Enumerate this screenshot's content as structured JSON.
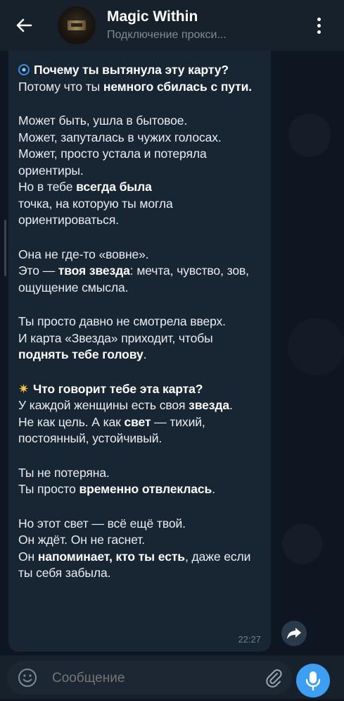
{
  "header": {
    "title": "Magic Within",
    "status": "Подключение прокси..."
  },
  "message": {
    "heading1": "Почему ты вытянула эту карту?",
    "p1_text": "Потому что ты ",
    "p1_bold": "немного сбилась с пути.",
    "p2_line1": "Может быть, ушла в бытовое.",
    "p2_line2": "Может, запуталась в чужих голосах.",
    "p2_line3": "Может, просто устала и потеряла ориентиры.",
    "p2_line4_a": "Но в тебе ",
    "p2_line4_bold": "всегда была",
    "p2_line5": "точка, на которую ты могла ориентироваться.",
    "p3_line1": "Она не где-то «вовне».",
    "p3_line2_a": "Это — ",
    "p3_line2_bold": "твоя звезда",
    "p3_line2_b": ": мечта, чувство, зов, ощущение смысла.",
    "p4_line1": "Ты просто давно не смотрела вверх.",
    "p4_line2": "И карта «Звезда» приходит, чтобы ",
    "p4_line2_bold": "поднять тебе голову",
    "p4_line2_end": ".",
    "heading2": "Что говорит тебе эта карта?",
    "p5_line1_a": "У каждой женщины есть своя ",
    "p5_line1_bold": "звезда",
    "p5_line1_end": ".",
    "p5_line2_a": "Не как цель. А как ",
    "p5_line2_bold": "свет",
    "p5_line2_b": " — тихий, постоянный, устойчивый.",
    "p6_line1": "Ты не потеряна.",
    "p6_line2_a": "Ты просто ",
    "p6_line2_bold": "временно отвлеклась",
    "p6_line2_end": ".",
    "p7_line1": "Но этот свет — всё ещё твой.",
    "p7_line2": "Он ждёт. Он не гаснет.",
    "p7_line3_a": "Он ",
    "p7_line3_bold": "напоминает, кто ты есть",
    "p7_line3_b": ", даже если ты себя забыла.",
    "time": "22:27"
  },
  "composer": {
    "placeholder": "Сообщение"
  },
  "icons": {
    "back": "arrow-left-icon",
    "menu": "vertical-dots-icon",
    "forward": "share-arrow-icon",
    "emoji": "smiley-icon",
    "attach": "paperclip-icon",
    "mic": "microphone-icon",
    "swirl": "cyclone-emoji",
    "star": "glowing-star-emoji"
  },
  "colors": {
    "background": "#0e1621",
    "bar": "#17212b",
    "bubble": "#182533",
    "accent": "#3e9ef2"
  }
}
